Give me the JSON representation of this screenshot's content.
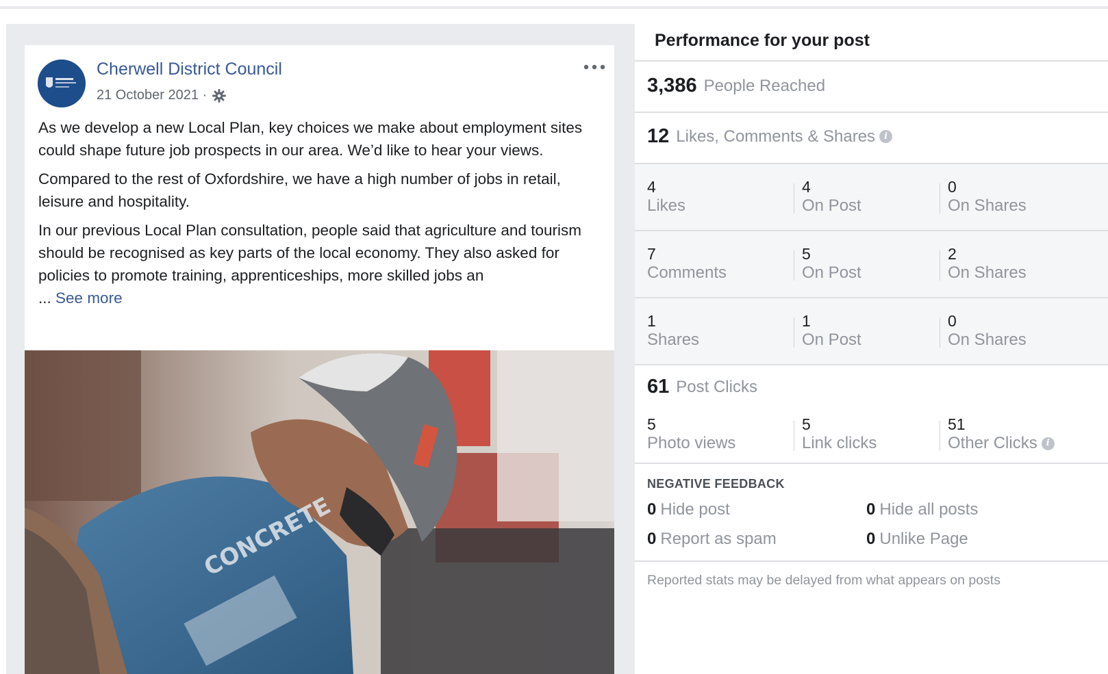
{
  "post": {
    "page_name": "Cherwell District Council",
    "date": "21 October 2021 ·",
    "paragraphs": [
      "As we develop a new Local Plan, key choices we make about employment sites could shape future job prospects in our area. We’d like to hear your views.",
      "Compared to the rest of Oxfordshire, we have a high number of jobs in retail, leisure and hospitality.",
      "In our previous Local Plan consultation, people said that agriculture and tourism should be recognised as key parts of the local economy. They also asked for policies to promote training, apprenticeships, more skilled jobs an"
    ],
    "ellipsis": "...",
    "see_more": "See more",
    "more_icon": "ellipsis-icon",
    "privacy_icon": "gear-icon"
  },
  "insights": {
    "title": "Performance for your post",
    "reached": {
      "value": "3,386",
      "label": "People Reached"
    },
    "engagement": {
      "value": "12",
      "label": "Likes, Comments & Shares"
    },
    "rows": [
      {
        "total": "4",
        "total_label": "Likes",
        "on_post": "4",
        "on_post_label": "On Post",
        "on_shares": "0",
        "on_shares_label": "On Shares"
      },
      {
        "total": "7",
        "total_label": "Comments",
        "on_post": "5",
        "on_post_label": "On Post",
        "on_shares": "2",
        "on_shares_label": "On Shares"
      },
      {
        "total": "1",
        "total_label": "Shares",
        "on_post": "1",
        "on_post_label": "On Post",
        "on_shares": "0",
        "on_shares_label": "On Shares"
      }
    ],
    "post_clicks": {
      "value": "61",
      "label": "Post Clicks"
    },
    "clicks": [
      {
        "value": "5",
        "label": "Photo views"
      },
      {
        "value": "5",
        "label": "Link clicks"
      },
      {
        "value": "51",
        "label": "Other Clicks"
      }
    ],
    "negative_feedback": {
      "heading": "NEGATIVE FEEDBACK",
      "items": [
        {
          "value": "0",
          "label": "Hide post"
        },
        {
          "value": "0",
          "label": "Hide all posts"
        },
        {
          "value": "0",
          "label": "Report as spam"
        },
        {
          "value": "0",
          "label": "Unlike Page"
        }
      ]
    },
    "footnote": "Reported stats may be delayed from what appears on posts"
  },
  "colors": {
    "link": "#385898",
    "muted": "#90949c",
    "panel_bg": "#e9ebee",
    "block_bg": "#f5f6f7",
    "avatar_bg": "#1e4d8c"
  }
}
